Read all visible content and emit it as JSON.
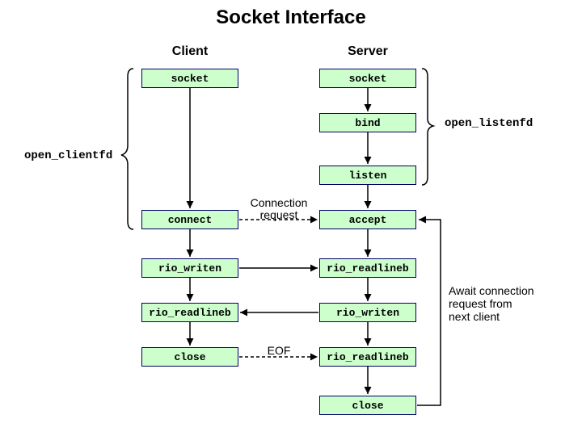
{
  "title": "Socket Interface",
  "headers": {
    "client": "Client",
    "server": "Server"
  },
  "client": {
    "socket": "socket",
    "connect": "connect",
    "rio_writen": "rio_writen",
    "rio_readlineb": "rio_readlineb",
    "close": "close"
  },
  "server": {
    "socket": "socket",
    "bind": "bind",
    "listen": "listen",
    "accept": "accept",
    "rio_readlineb": "rio_readlineb",
    "rio_writen": "rio_writen",
    "rio_readlineb2": "rio_readlineb",
    "close": "close"
  },
  "sidelabels": {
    "open_clientfd": "open_clientfd",
    "open_listenfd": "open_listenfd"
  },
  "midlabels": {
    "connreq1": "Connection",
    "connreq2": "request",
    "eof": "EOF"
  },
  "anno": {
    "await1": "Await connection",
    "await2": "request from",
    "await3": "next client"
  }
}
